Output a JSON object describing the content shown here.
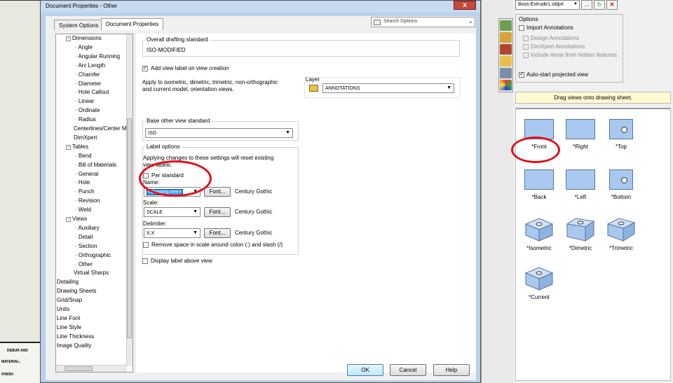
{
  "background": {
    "title_block": [
      "DEBUR AND",
      "MATERIAL:",
      "FINISH:"
    ]
  },
  "dialog": {
    "title": "Document Properties - Other",
    "close_label": "x",
    "tabs": [
      "System Options",
      "Document Properties"
    ],
    "search_placeholder": "Search Options",
    "tree": [
      {
        "label": "Dimensions",
        "level": 1,
        "expander": "-"
      },
      {
        "label": "Angle",
        "level": 2
      },
      {
        "label": "Angular Running",
        "level": 2
      },
      {
        "label": "Arc Length",
        "level": 2
      },
      {
        "label": "Chamfer",
        "level": 2
      },
      {
        "label": "Diameter",
        "level": 2
      },
      {
        "label": "Hole Callout",
        "level": 2
      },
      {
        "label": "Linear",
        "level": 2
      },
      {
        "label": "Ordinate",
        "level": 2
      },
      {
        "label": "Radius",
        "level": 2
      },
      {
        "label": "Centerlines/Center Ma",
        "level": 1
      },
      {
        "label": "DimXpert",
        "level": 1
      },
      {
        "label": "Tables",
        "level": 1,
        "expander": "-"
      },
      {
        "label": "Bend",
        "level": 2
      },
      {
        "label": "Bill of Materials",
        "level": 2
      },
      {
        "label": "General",
        "level": 2
      },
      {
        "label": "Hole",
        "level": 2
      },
      {
        "label": "Punch",
        "level": 2
      },
      {
        "label": "Revision",
        "level": 2
      },
      {
        "label": "Weld",
        "level": 2
      },
      {
        "label": "Views",
        "level": 1,
        "expander": "-"
      },
      {
        "label": "Auxiliary",
        "level": 2
      },
      {
        "label": "Detail",
        "level": 2
      },
      {
        "label": "Section",
        "level": 2
      },
      {
        "label": "Orthographic",
        "level": 2
      },
      {
        "label": "Other",
        "level": 2
      },
      {
        "label": "Virtual Sharps",
        "level": 1
      },
      {
        "label": "Detailing",
        "level": 0
      },
      {
        "label": "Drawing Sheets",
        "level": 0
      },
      {
        "label": "Grid/Snap",
        "level": 0
      },
      {
        "label": "Units",
        "level": 0
      },
      {
        "label": "Line Font",
        "level": 0
      },
      {
        "label": "Line Style",
        "level": 0
      },
      {
        "label": "Line Thickness",
        "level": 0
      },
      {
        "label": "Image Quality",
        "level": 0
      }
    ],
    "content": {
      "overall_title": "Overall drafting standard",
      "overall_value": "ISO-MODIFIED",
      "add_view_label": "Add view label on view creation",
      "apply_text_1": "Apply to isometric, dimetric, trimetric, non-orthographic",
      "apply_text_2": "and current model, orientation views.",
      "layer_label": "Layer",
      "layer_value": "ANNOTATIONS",
      "base_title": "Base other view standard",
      "base_value": "ISO",
      "label_options_title": "Label options",
      "label_note_1": "Applying changes to these settings will reset existing",
      "label_note_2": "view labels.",
      "per_standard": "Per standard",
      "name_label": "Name:",
      "name_value": "<Drawing tree>",
      "font_btn": "Font...",
      "font_name": "Century Gothic",
      "scale_label": "Scale:",
      "scale_value": "SCALE",
      "delimiter_label": "Delimiter:",
      "delimiter_value": "X:X",
      "remove_space": "Remove space in scale around colon (:) and slash (/)",
      "display_above": "Display label above view"
    },
    "buttons": {
      "ok": "OK",
      "cancel": "Cancel",
      "help": "Help"
    }
  },
  "property_manager": {
    "part_combo": "Boss-Extrude1.sldprt",
    "more_btn": "...",
    "options_header": "Options",
    "import_annotations": "Import Annotations",
    "design_annotations": "Design Annotations",
    "dimxpert_annotations": "DimXpert Annotations",
    "hidden_features": "Include items from hidden features",
    "auto_start": "Auto-start projected view",
    "drag_banner": "Drag views onto drawing sheet.",
    "views": [
      {
        "label": "*Front",
        "shape": "square"
      },
      {
        "label": "*Right",
        "shape": "square"
      },
      {
        "label": "*Top",
        "shape": "square-hole"
      },
      {
        "label": "*Back",
        "shape": "square"
      },
      {
        "label": "*Left",
        "shape": "square"
      },
      {
        "label": "*Bottom",
        "shape": "square-hole"
      },
      {
        "label": "*Isometric",
        "shape": "iso"
      },
      {
        "label": "*Dimetric",
        "shape": "iso"
      },
      {
        "label": "*Trimetric",
        "shape": "iso"
      },
      {
        "label": "*Current",
        "shape": "iso"
      }
    ]
  },
  "colors": {
    "annotation_oval": "#e0101a",
    "view_fill": "#a8c8f0",
    "banner": "#fffbd0"
  }
}
